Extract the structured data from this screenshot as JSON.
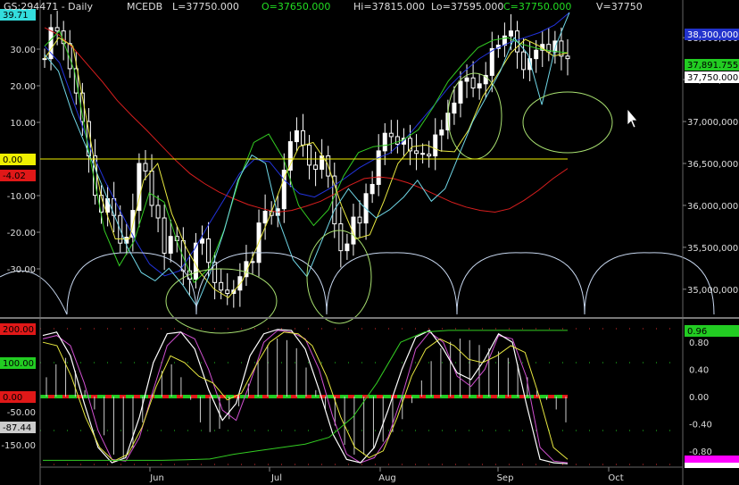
{
  "header": {
    "symbol": "GS:294471 - Daily",
    "indicator": "MCEDB",
    "last": "L=37750.000",
    "open": "O=37650.000",
    "high": "Hi=37815.000",
    "low": "Lo=37595.000",
    "close": "C=37750.000",
    "volume": "V=37750"
  },
  "colors": {
    "background": "#000000",
    "candle_up": "#ffffff",
    "ma_red": "#d81e1e",
    "ma_blue": "#2233dd",
    "ma_green": "#33cc22",
    "ma_yellow": "#e8e840",
    "cycle_cyan": "#6fd6e6",
    "arc_white": "#c8d8f0",
    "ellipse": "#a8e070",
    "stoch_magenta": "#d050d0",
    "stoch_white": "#ffffff",
    "badge_red": "#e01818",
    "badge_green": "#22cc22",
    "badge_cyan": "#33dddd",
    "badge_blue": "#2233cc",
    "badge_yellow": "#f0f000"
  },
  "left_axis": {
    "ticks": [
      "30.00",
      "20.00",
      "10.00",
      "-10.00",
      "-20.00",
      "-30.00"
    ],
    "badges": {
      "top": "39.71",
      "zero": "0.00",
      "red": "-4.02"
    }
  },
  "right_axis": {
    "ticks": [
      "38,000,000",
      "37,500,000",
      "37,000,000",
      "36,500,000",
      "36,000,000",
      "35,500,000",
      "35,000,000"
    ],
    "badges": {
      "blue": "38,300,000",
      "green": "37,891.755",
      "price": "37,750.000"
    }
  },
  "lower_left_axis": {
    "ticks": [
      "-50.00",
      "-150.00"
    ],
    "badges": {
      "top": "200.00",
      "mid": "100.00",
      "zero": "0.00",
      "value": "-87.44"
    }
  },
  "lower_right_axis": {
    "ticks": [
      "0.80",
      "0.40",
      "0.00",
      "-0.40",
      "-0.80"
    ],
    "badges": {
      "top": "0.96"
    }
  },
  "x_axis": {
    "labels": [
      "Jun",
      "Jul",
      "Aug",
      "Sep",
      "Oct"
    ]
  },
  "chart_data": [
    {
      "type": "candlestick",
      "title": "GS:294471 - Daily",
      "x_labels": [
        "Jun",
        "Jul",
        "Aug",
        "Sep",
        "Oct"
      ],
      "y_right_range": [
        34700000,
        38300000
      ],
      "y_left_range": [
        -40,
        40
      ],
      "grid": false,
      "closes_approx": [
        37750000,
        38120000,
        38080000,
        37930000,
        37630000,
        37340000,
        37000000,
        36590000,
        36120000,
        35920000,
        36080000,
        35880000,
        35550000,
        35620000,
        35940000,
        36500000,
        36410000,
        36000000,
        35850000,
        35430000,
        35630000,
        35580000,
        35220000,
        35120000,
        35550000,
        35600000,
        35320000,
        35080000,
        34990000,
        34950000,
        34990000,
        35150000,
        35330000,
        35320000,
        35790000,
        35930000,
        35880000,
        35960000,
        36420000,
        36760000,
        36890000,
        36720000,
        36480000,
        36430000,
        36590000,
        36350000,
        35780000,
        35460000,
        35540000,
        35860000,
        35790000,
        36140000,
        36250000,
        36650000,
        36860000,
        36820000,
        36730000,
        36800000,
        36650000,
        36620000,
        36610000,
        36590000,
        36840000,
        36900000,
        37100000,
        37220000,
        37480000,
        37520000,
        37400000,
        37450000,
        37550000,
        37870000,
        37910000,
        38020000,
        38080000,
        37830000,
        37620000,
        37750000,
        37850000,
        37920000,
        37830000,
        37960000,
        37780000,
        37750000
      ],
      "series": [
        {
          "name": "",
          "color": "red",
          "values": [
            38120000,
            38030000,
            37870000,
            37670000,
            37470000,
            37250000,
            37070000,
            36900000,
            36720000,
            36540000,
            36380000,
            36260000,
            36160000,
            36080000,
            36010000,
            35960000,
            35920000,
            35940000,
            35990000,
            36050000,
            36140000,
            36240000,
            36320000,
            36340000,
            36320000,
            36270000,
            36200000,
            36120000,
            36040000,
            35980000,
            35940000,
            35920000,
            35960000,
            36060000,
            36180000,
            36320000,
            36440000
          ]
        },
        {
          "name": "",
          "color": "blue",
          "values": [
            37900000,
            37700000,
            37200000,
            36700000,
            36300000,
            35950000,
            35600000,
            35300000,
            35160000,
            35220000,
            35480000,
            35790000,
            36080000,
            36380000,
            36550000,
            36520000,
            36300000,
            36140000,
            36100000,
            36200000,
            36320000,
            36450000,
            36550000,
            36620000,
            36780000,
            36990000,
            37200000,
            37420000,
            37600000,
            37750000,
            37860000,
            37940000,
            38000000,
            38060000,
            38150000,
            38300000
          ]
        },
        {
          "name": "",
          "color": "green",
          "values": [
            37900000,
            38080000,
            37600000,
            36600000,
            35700000,
            35280000,
            35580000,
            36150000,
            36040000,
            35500000,
            35080000,
            35250000,
            35700000,
            36300000,
            36750000,
            36850000,
            36550000,
            36000000,
            35760000,
            35950000,
            36350000,
            36630000,
            36700000,
            36720000,
            36780000,
            36900000,
            37170000,
            37480000,
            37690000,
            37880000,
            37970000,
            38000000,
            37920000,
            37870000,
            37840000,
            37820000
          ]
        },
        {
          "name": "",
          "color": "yellow",
          "values": [
            37750000,
            38000000,
            37900000,
            37000000,
            36100000,
            35600000,
            35600000,
            36300000,
            36500000,
            35900000,
            35500000,
            35200000,
            35000000,
            34900000,
            35100000,
            35500000,
            35900000,
            36350000,
            36700000,
            36750000,
            36500000,
            36000000,
            35600000,
            35650000,
            36050000,
            36500000,
            36700000,
            36720000,
            36650000,
            36640000,
            36900000,
            37300000,
            37550000,
            37820000,
            37980000,
            37900000,
            37780000,
            37820000
          ]
        },
        {
          "name": "",
          "color": "cyan",
          "values": [
            37800000,
            37600000,
            37100000,
            36700000,
            36300000,
            35900000,
            35500000,
            35200000,
            35100000,
            35250000,
            35050000,
            34800000,
            35200000,
            35700000,
            36300000,
            36600000,
            36500000,
            35800000,
            35350000,
            35150000,
            35550000,
            35950000,
            36200000,
            36000000,
            35850000,
            35950000,
            36100000,
            36300000,
            36050000,
            36200000,
            36600000,
            37000000,
            37300000,
            37600000,
            38000000,
            37800000,
            37200000,
            37900000,
            38300000
          ]
        }
      ]
    },
    {
      "type": "line",
      "title": "",
      "x_labels": [
        "Jun",
        "Jul",
        "Aug",
        "Sep",
        "Oct"
      ],
      "y_left_range": [
        -200,
        200
      ],
      "y_right_range": [
        -1,
        1
      ],
      "grid": false,
      "histogram": [
        60,
        100,
        120,
        80,
        20,
        -40,
        -120,
        -180,
        -190,
        -160,
        -80,
        10,
        80,
        100,
        60,
        -10,
        -80,
        -110,
        -100,
        -70,
        -30,
        40,
        110,
        160,
        180,
        175,
        150,
        90,
        20,
        -40,
        -90,
        -150,
        -180,
        -180,
        -160,
        -140,
        -110,
        -70,
        -20,
        50,
        110,
        150,
        170,
        180,
        175,
        160,
        150,
        140,
        120,
        100,
        60,
        20,
        -10,
        -40,
        -80
      ],
      "series": [
        {
          "name": "",
          "color": "magenta",
          "values": [
            170,
            180,
            150,
            40,
            -100,
            -185,
            -190,
            -120,
            20,
            150,
            190,
            170,
            80,
            -40,
            -70,
            40,
            160,
            195,
            190,
            170,
            80,
            -60,
            -170,
            -195,
            -180,
            -120,
            0,
            140,
            190,
            160,
            60,
            30,
            80,
            180,
            170,
            60,
            -150,
            -190,
            -195
          ]
        },
        {
          "name": "",
          "color": "white",
          "values": [
            180,
            190,
            120,
            -20,
            -150,
            -195,
            -180,
            -60,
            100,
            185,
            190,
            140,
            20,
            -70,
            -20,
            120,
            185,
            198,
            195,
            140,
            20,
            -110,
            -185,
            -195,
            -150,
            -40,
            80,
            175,
            195,
            140,
            70,
            50,
            110,
            185,
            160,
            -20,
            -185,
            -195,
            -198
          ]
        },
        {
          "name": "",
          "color": "yellow",
          "values": [
            160,
            150,
            60,
            -60,
            -150,
            -190,
            -170,
            -90,
            30,
            120,
            100,
            60,
            40,
            -10,
            10,
            90,
            160,
            190,
            185,
            150,
            60,
            -60,
            -150,
            -180,
            -160,
            -60,
            60,
            140,
            170,
            150,
            110,
            100,
            120,
            150,
            130,
            0,
            -150,
            -185
          ]
        },
        {
          "name": "",
          "color": "green",
          "values": [
            -188,
            -188,
            -188,
            -188,
            -188,
            -188,
            -186,
            -184,
            -170,
            -160,
            -150,
            -140,
            -120,
            -60,
            40,
            160,
            190,
            195,
            195,
            195,
            195,
            195,
            195
          ]
        }
      ]
    }
  ]
}
